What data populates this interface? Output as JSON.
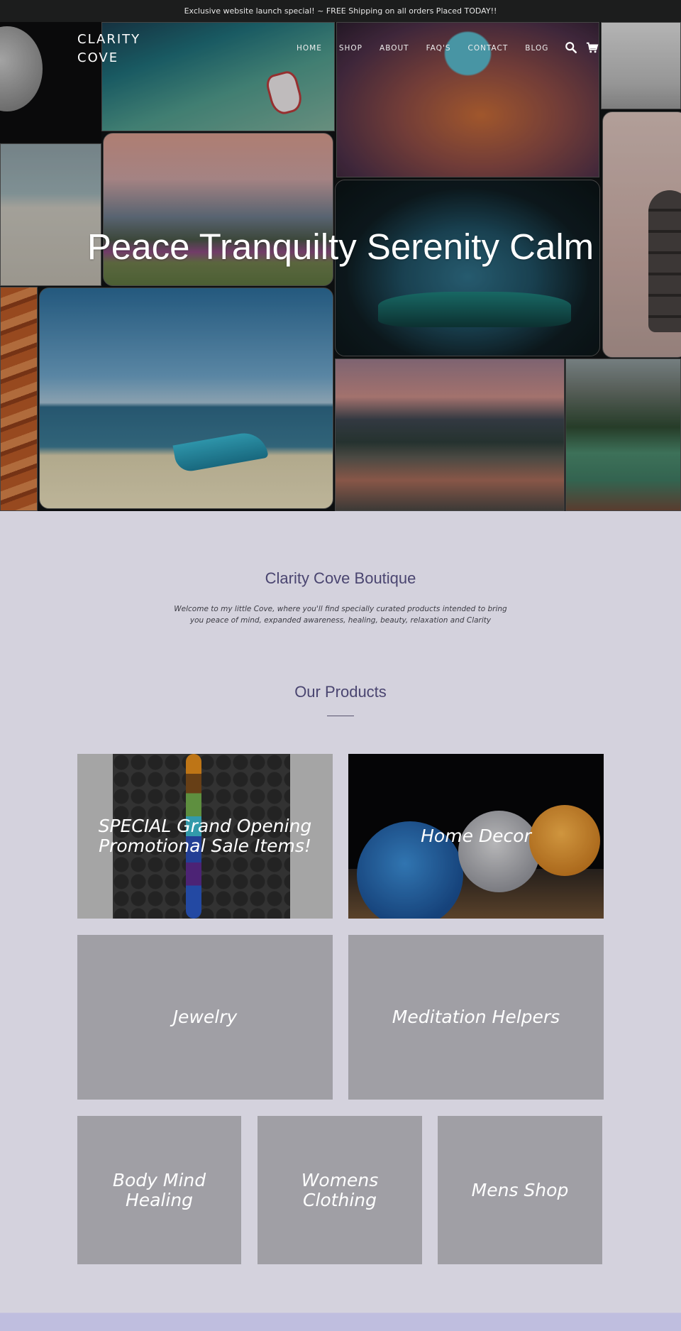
{
  "announcement": {
    "text": "Exclusive website launch special! ~ FREE Shipping on all orders Placed TODAY!!"
  },
  "header": {
    "logo_line1": "CLARITY",
    "logo_line2": "COVE",
    "nav": [
      {
        "label": "HOME"
      },
      {
        "label": "SHOP"
      },
      {
        "label": "ABOUT"
      },
      {
        "label": "FAQ'S"
      },
      {
        "label": "CONTACT"
      },
      {
        "label": "BLOG"
      }
    ],
    "icons": {
      "search": "search-icon",
      "cart": "cart-icon"
    }
  },
  "hero": {
    "title": "Peace Tranquilty Serenity Calm"
  },
  "intro": {
    "heading": "Clarity Cove Boutique",
    "body": "Welcome to my little Cove, where you'll find specially curated products intended to bring you peace of mind, expanded awareness, healing, beauty, relaxation and Clarity"
  },
  "products": {
    "heading": "Our Products",
    "collections": [
      {
        "label": "SPECIAL Grand Opening Promotional Sale Items!"
      },
      {
        "label": "Home Decor"
      },
      {
        "label": "Jewelry"
      },
      {
        "label": "Meditation Helpers"
      },
      {
        "label": "Body Mind Healing"
      },
      {
        "label": "Womens Clothing"
      },
      {
        "label": "Mens Shop"
      }
    ]
  },
  "colors": {
    "page_background": "#d4d2dd",
    "heading_color": "#4a4570",
    "announcement_bar": "#1c1d1d",
    "placeholder_tile": "#a09fa5",
    "footer_band": "#bfbedf"
  }
}
